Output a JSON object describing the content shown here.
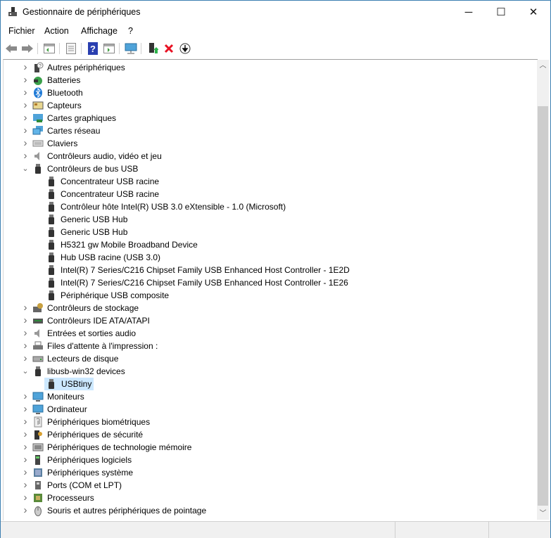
{
  "window": {
    "title": "Gestionnaire de périphériques",
    "minimize": "─",
    "maximize": "☐",
    "close": "✕"
  },
  "menu": [
    "Fichier",
    "Action",
    "Affichage",
    "?"
  ],
  "toolbar": [
    "back-icon",
    "forward-icon",
    "show-hide-console-tree-icon",
    "properties-icon",
    "help-icon",
    "show-action-pane-icon",
    "scan-hardware-icon",
    "update-driver-icon",
    "uninstall-icon",
    "disable-icon"
  ],
  "colors": {
    "selection": "#cce8ff",
    "uninstall": "#e81123",
    "border": "#3c7fb1"
  },
  "tree": [
    {
      "label": "Autres périphériques",
      "level": 0,
      "state": "collapsed",
      "icon": "other-devices"
    },
    {
      "label": "Batteries",
      "level": 0,
      "state": "collapsed",
      "icon": "battery"
    },
    {
      "label": "Bluetooth",
      "level": 0,
      "state": "collapsed",
      "icon": "bluetooth"
    },
    {
      "label": "Capteurs",
      "level": 0,
      "state": "collapsed",
      "icon": "sensor"
    },
    {
      "label": "Cartes graphiques",
      "level": 0,
      "state": "collapsed",
      "icon": "display-adapter"
    },
    {
      "label": "Cartes réseau",
      "level": 0,
      "state": "collapsed",
      "icon": "network"
    },
    {
      "label": "Claviers",
      "level": 0,
      "state": "collapsed",
      "icon": "keyboard"
    },
    {
      "label": "Contrôleurs audio, vidéo et jeu",
      "level": 0,
      "state": "collapsed",
      "icon": "audio"
    },
    {
      "label": "Contrôleurs de bus USB",
      "level": 0,
      "state": "expanded",
      "icon": "usb"
    },
    {
      "label": "Concentrateur USB racine",
      "level": 1,
      "icon": "usb"
    },
    {
      "label": "Concentrateur USB racine",
      "level": 1,
      "icon": "usb"
    },
    {
      "label": "Contrôleur hôte Intel(R) USB 3.0 eXtensible - 1.0 (Microsoft)",
      "level": 1,
      "icon": "usb"
    },
    {
      "label": "Generic USB Hub",
      "level": 1,
      "icon": "usb"
    },
    {
      "label": "Generic USB Hub",
      "level": 1,
      "icon": "usb"
    },
    {
      "label": "H5321 gw Mobile Broadband Device",
      "level": 1,
      "icon": "usb"
    },
    {
      "label": "Hub USB racine (USB 3.0)",
      "level": 1,
      "icon": "usb"
    },
    {
      "label": "Intel(R) 7 Series/C216 Chipset Family USB Enhanced Host Controller - 1E2D",
      "level": 1,
      "icon": "usb"
    },
    {
      "label": "Intel(R) 7 Series/C216 Chipset Family USB Enhanced Host Controller - 1E26",
      "level": 1,
      "icon": "usb"
    },
    {
      "label": "Périphérique USB composite",
      "level": 1,
      "icon": "usb"
    },
    {
      "label": "Contrôleurs de stockage",
      "level": 0,
      "state": "collapsed",
      "icon": "storage"
    },
    {
      "label": "Contrôleurs IDE ATA/ATAPI",
      "level": 0,
      "state": "collapsed",
      "icon": "ide"
    },
    {
      "label": "Entrées et sorties audio",
      "level": 0,
      "state": "collapsed",
      "icon": "audio"
    },
    {
      "label": "Files d'attente à l'impression :",
      "level": 0,
      "state": "collapsed",
      "icon": "printer"
    },
    {
      "label": "Lecteurs de disque",
      "level": 0,
      "state": "collapsed",
      "icon": "disk"
    },
    {
      "label": "libusb-win32 devices",
      "level": 0,
      "state": "expanded",
      "icon": "usb"
    },
    {
      "label": "USBtiny",
      "level": 1,
      "icon": "usb",
      "selected": true
    },
    {
      "label": "Moniteurs",
      "level": 0,
      "state": "collapsed",
      "icon": "monitor"
    },
    {
      "label": "Ordinateur",
      "level": 0,
      "state": "collapsed",
      "icon": "monitor"
    },
    {
      "label": "Périphériques biométriques",
      "level": 0,
      "state": "collapsed",
      "icon": "fingerprint"
    },
    {
      "label": "Périphériques de sécurité",
      "level": 0,
      "state": "collapsed",
      "icon": "security"
    },
    {
      "label": "Périphériques de technologie mémoire",
      "level": 0,
      "state": "collapsed",
      "icon": "memory"
    },
    {
      "label": "Périphériques logiciels",
      "level": 0,
      "state": "collapsed",
      "icon": "software"
    },
    {
      "label": "Périphériques système",
      "level": 0,
      "state": "collapsed",
      "icon": "system"
    },
    {
      "label": "Ports (COM et LPT)",
      "level": 0,
      "state": "collapsed",
      "icon": "port"
    },
    {
      "label": "Processeurs",
      "level": 0,
      "state": "collapsed",
      "icon": "cpu"
    },
    {
      "label": "Souris et autres périphériques de pointage",
      "level": 0,
      "state": "collapsed",
      "icon": "mouse"
    }
  ]
}
